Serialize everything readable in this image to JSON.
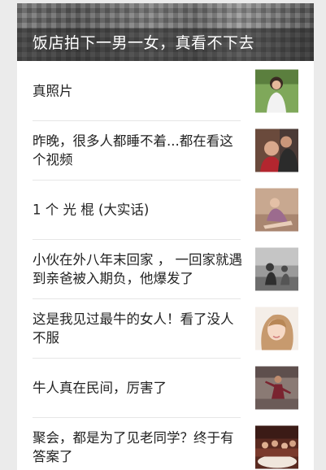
{
  "header": {
    "title": "饭店拍下一男一女，真看不下去"
  },
  "items": [
    {
      "title": "真照片",
      "thumb": "photo-woman-field"
    },
    {
      "title": "昨晚，很多人都睡不着...都在看这个视频",
      "thumb": "photo-couple"
    },
    {
      "title": "1 个 光 棍 (大实话)",
      "thumb": "photo-woman-sitting"
    },
    {
      "title": "小伙在外八年末回家 ， 一回家就遇到亲爸被入期负，他爆发了",
      "thumb": "photo-street"
    },
    {
      "title": "这是我见过最牛的女人！看了没人不服",
      "thumb": "photo-woman-portrait"
    },
    {
      "title": "牛人真在民间，厉害了",
      "thumb": "photo-performer"
    },
    {
      "title": "聚会，都是为了见老同学？终于有答案了",
      "thumb": "photo-party"
    }
  ]
}
